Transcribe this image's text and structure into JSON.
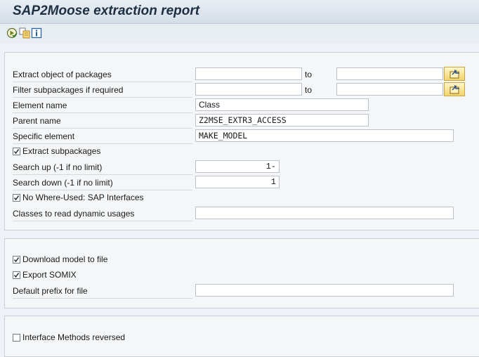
{
  "title": "SAP2Moose extraction report",
  "toolbar": {
    "icons": [
      "execute-icon",
      "variant-icon",
      "info-icon"
    ]
  },
  "section1": {
    "extract_packages": {
      "label": "Extract object of packages",
      "from": "",
      "to_label": "to",
      "to": ""
    },
    "filter_subpackages": {
      "label": "Filter subpackages if required",
      "from": "",
      "to_label": "to",
      "to": ""
    },
    "element_name": {
      "label": "Element name",
      "value": "Class"
    },
    "parent_name": {
      "label": "Parent name",
      "value": "Z2MSE_EXTR3_ACCESS"
    },
    "specific_element": {
      "label": "Specific element",
      "value": "MAKE_MODEL"
    },
    "extract_subpackages": {
      "label": "Extract subpackages",
      "checked": true
    },
    "search_up": {
      "label": "Search up (-1 if no limit)",
      "value": "1-"
    },
    "search_down": {
      "label": "Search down (-1 if no limit)",
      "value": "1"
    },
    "no_where_used": {
      "label": "No Where-Used: SAP Interfaces",
      "checked": true
    },
    "classes_dynamic": {
      "label": "Classes to read dynamic usages",
      "value": ""
    }
  },
  "section2": {
    "download_model": {
      "label": "Download model to file",
      "checked": true
    },
    "export_somix": {
      "label": "Export SOMIX",
      "checked": true
    },
    "default_prefix": {
      "label": "Default prefix for file",
      "value": ""
    }
  },
  "section3": {
    "interface_methods": {
      "label": "Interface Methods reversed",
      "checked": false
    }
  },
  "colors": {
    "selection_button": "#f2d36b",
    "panel": "#f4f6f8",
    "title": "#1d2f43"
  }
}
